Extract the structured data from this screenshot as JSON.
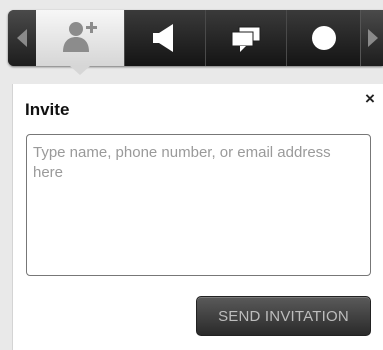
{
  "toolbar": {
    "tabs": [
      {
        "icon": "add-user-icon",
        "active": true
      },
      {
        "icon": "megaphone-icon",
        "active": false
      },
      {
        "icon": "chat-icon",
        "active": false
      },
      {
        "icon": "circle-icon",
        "active": false
      }
    ],
    "nav_left_icon": "chevron-left-icon",
    "nav_right_icon": "chevron-right-icon",
    "colors": {
      "bar": "#1e1e1e",
      "active_tab": "#e6e6e6"
    }
  },
  "popup": {
    "title": "Invite",
    "close_label": "×",
    "input": {
      "value": "",
      "placeholder": "Type name, phone number, or email address here"
    },
    "send_label": "SEND INVITATION"
  }
}
